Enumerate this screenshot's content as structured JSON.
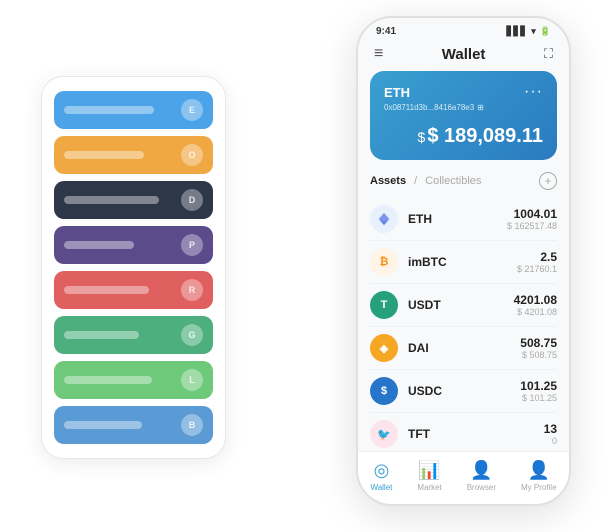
{
  "scene": {
    "phone": {
      "status_time": "9:41",
      "title": "Wallet",
      "eth_card": {
        "name": "ETH",
        "address": "0x08711d3b...8416a78e3",
        "balance": "$ 189,089.11",
        "dollar_sign": "$"
      },
      "assets_tab": "Assets",
      "collectibles_tab": "Collectibles",
      "assets": [
        {
          "symbol": "ETH",
          "icon_type": "eth",
          "amount": "1004.01",
          "usd": "$ 162517.48"
        },
        {
          "symbol": "imBTC",
          "icon_type": "imbtc",
          "amount": "2.5",
          "usd": "$ 21760.1"
        },
        {
          "symbol": "USDT",
          "icon_type": "usdt",
          "amount": "4201.08",
          "usd": "$ 4201.08"
        },
        {
          "symbol": "DAI",
          "icon_type": "dai",
          "amount": "508.75",
          "usd": "$ 508.75"
        },
        {
          "symbol": "USDC",
          "icon_type": "usdc",
          "amount": "101.25",
          "usd": "$ 101.25"
        },
        {
          "symbol": "TFT",
          "icon_type": "tft",
          "amount": "13",
          "usd": "0"
        }
      ],
      "nav": [
        {
          "label": "Wallet",
          "active": true
        },
        {
          "label": "Market",
          "active": false
        },
        {
          "label": "Browser",
          "active": false
        },
        {
          "label": "My Profile",
          "active": false
        }
      ]
    },
    "card_stack": {
      "items": [
        {
          "color": "ci-blue",
          "dot_label": "E"
        },
        {
          "color": "ci-orange",
          "dot_label": "O"
        },
        {
          "color": "ci-dark",
          "dot_label": "D"
        },
        {
          "color": "ci-purple",
          "dot_label": "P"
        },
        {
          "color": "ci-red",
          "dot_label": "R"
        },
        {
          "color": "ci-green",
          "dot_label": "G"
        },
        {
          "color": "ci-lightgreen",
          "dot_label": "L"
        },
        {
          "color": "ci-lightblue",
          "dot_label": "B"
        }
      ]
    }
  }
}
